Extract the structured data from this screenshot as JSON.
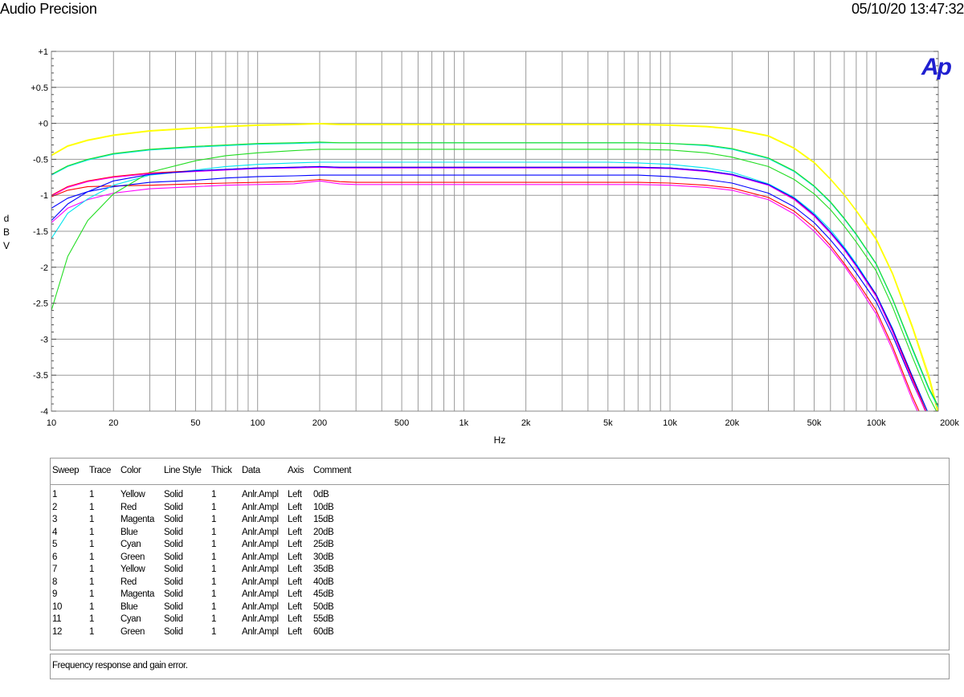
{
  "header": {
    "brand": "Audio Precision",
    "timestamp": "05/10/20 13:47:32"
  },
  "logo": {
    "text": "Ap",
    "color": "#1f1fd0"
  },
  "chart_data": {
    "type": "line",
    "xscale": "log",
    "xlim": [
      10,
      200000
    ],
    "ylim": [
      -4,
      1
    ],
    "xlabel": "Hz",
    "ylabel": "dBV",
    "ylabel_letters": [
      "d",
      "B",
      "V"
    ],
    "grid": true,
    "xticks": [
      {
        "v": 10,
        "label": "10"
      },
      {
        "v": 20,
        "label": "20"
      },
      {
        "v": 50,
        "label": "50"
      },
      {
        "v": 100,
        "label": "100"
      },
      {
        "v": 200,
        "label": "200"
      },
      {
        "v": 500,
        "label": "500"
      },
      {
        "v": 1000,
        "label": "1k"
      },
      {
        "v": 2000,
        "label": "2k"
      },
      {
        "v": 5000,
        "label": "5k"
      },
      {
        "v": 10000,
        "label": "10k"
      },
      {
        "v": 20000,
        "label": "20k"
      },
      {
        "v": 50000,
        "label": "50k"
      },
      {
        "v": 100000,
        "label": "100k"
      },
      {
        "v": 200000,
        "label": "200k"
      }
    ],
    "yticks": [
      {
        "v": 1,
        "label": "+1"
      },
      {
        "v": 0.5,
        "label": "+0.5"
      },
      {
        "v": 0,
        "label": "+0"
      },
      {
        "v": -0.5,
        "label": "-0.5"
      },
      {
        "v": -1,
        "label": "-1"
      },
      {
        "v": -1.5,
        "label": "-1.5"
      },
      {
        "v": -2,
        "label": "-2"
      },
      {
        "v": -2.5,
        "label": "-2.5"
      },
      {
        "v": -3,
        "label": "-3"
      },
      {
        "v": -3.5,
        "label": "-3.5"
      },
      {
        "v": -4,
        "label": "-4"
      }
    ],
    "x": [
      10,
      12,
      15,
      20,
      30,
      50,
      70,
      100,
      150,
      200,
      250,
      300,
      500,
      1000,
      2000,
      3000,
      5000,
      7000,
      10000,
      15000,
      20000,
      30000,
      40000,
      50000,
      60000,
      70000,
      80000,
      100000,
      120000,
      150000,
      180000,
      200000
    ],
    "series": [
      {
        "color": "#ffff00",
        "values": [
          -0.45,
          -0.32,
          -0.24,
          -0.17,
          -0.11,
          -0.07,
          -0.05,
          -0.03,
          -0.02,
          -0.01,
          -0.02,
          -0.02,
          -0.02,
          -0.02,
          -0.02,
          -0.02,
          -0.02,
          -0.02,
          -0.03,
          -0.05,
          -0.08,
          -0.18,
          -0.35,
          -0.55,
          -0.78,
          -1.0,
          -1.22,
          -1.62,
          -2.1,
          -2.85,
          -3.55,
          -4.05
        ]
      },
      {
        "color": "#ff0000",
        "values": [
          -1.02,
          -0.93,
          -0.88,
          -0.87,
          -0.86,
          -0.84,
          -0.83,
          -0.82,
          -0.81,
          -0.78,
          -0.81,
          -0.82,
          -0.82,
          -0.82,
          -0.82,
          -0.82,
          -0.82,
          -0.82,
          -0.83,
          -0.86,
          -0.9,
          -1.03,
          -1.22,
          -1.45,
          -1.7,
          -1.95,
          -2.18,
          -2.6,
          -3.1,
          -3.8,
          -4.3,
          -4.5
        ]
      },
      {
        "color": "#ff00ff",
        "values": [
          -1.38,
          -1.18,
          -1.06,
          -0.97,
          -0.91,
          -0.88,
          -0.86,
          -0.85,
          -0.84,
          -0.8,
          -0.84,
          -0.85,
          -0.85,
          -0.85,
          -0.85,
          -0.85,
          -0.85,
          -0.85,
          -0.86,
          -0.89,
          -0.93,
          -1.06,
          -1.26,
          -1.5,
          -1.74,
          -1.98,
          -2.22,
          -2.65,
          -3.15,
          -3.85,
          -4.35,
          -4.55
        ]
      },
      {
        "color": "#0000ff",
        "values": [
          -1.18,
          -1.04,
          -0.95,
          -0.88,
          -0.82,
          -0.79,
          -0.76,
          -0.74,
          -0.73,
          -0.72,
          -0.72,
          -0.72,
          -0.72,
          -0.72,
          -0.72,
          -0.72,
          -0.72,
          -0.72,
          -0.74,
          -0.78,
          -0.83,
          -0.97,
          -1.16,
          -1.38,
          -1.62,
          -1.85,
          -2.08,
          -2.48,
          -2.95,
          -3.6,
          -4.1,
          -4.3
        ]
      },
      {
        "color": "#00e5ee",
        "values": [
          -1.6,
          -1.25,
          -1.05,
          -0.86,
          -0.72,
          -0.65,
          -0.6,
          -0.57,
          -0.55,
          -0.54,
          -0.54,
          -0.54,
          -0.54,
          -0.54,
          -0.54,
          -0.54,
          -0.54,
          -0.55,
          -0.57,
          -0.62,
          -0.68,
          -0.84,
          -1.03,
          -1.25,
          -1.48,
          -1.72,
          -1.95,
          -2.38,
          -2.85,
          -3.55,
          -4.05,
          -4.3
        ]
      },
      {
        "color": "#22dd22",
        "values": [
          -2.6,
          -1.85,
          -1.35,
          -0.98,
          -0.68,
          -0.52,
          -0.45,
          -0.41,
          -0.38,
          -0.36,
          -0.36,
          -0.36,
          -0.36,
          -0.36,
          -0.36,
          -0.36,
          -0.36,
          -0.36,
          -0.37,
          -0.41,
          -0.47,
          -0.6,
          -0.78,
          -0.98,
          -1.2,
          -1.43,
          -1.65,
          -2.05,
          -2.55,
          -3.25,
          -3.8,
          -4.05
        ]
      },
      {
        "color": "#ffff00",
        "values": [
          -0.44,
          -0.31,
          -0.23,
          -0.16,
          -0.1,
          -0.06,
          -0.04,
          -0.02,
          -0.01,
          0.0,
          -0.01,
          -0.01,
          -0.01,
          -0.01,
          -0.01,
          -0.01,
          -0.01,
          -0.01,
          -0.02,
          -0.04,
          -0.07,
          -0.17,
          -0.34,
          -0.54,
          -0.77,
          -0.99,
          -1.21,
          -1.6,
          -2.08,
          -2.82,
          -3.5,
          -4.0
        ]
      },
      {
        "color": "#ff0000",
        "values": [
          -1.0,
          -0.88,
          -0.8,
          -0.74,
          -0.69,
          -0.66,
          -0.64,
          -0.62,
          -0.61,
          -0.6,
          -0.61,
          -0.61,
          -0.61,
          -0.61,
          -0.61,
          -0.61,
          -0.61,
          -0.61,
          -0.62,
          -0.66,
          -0.71,
          -0.85,
          -1.05,
          -1.28,
          -1.52,
          -1.75,
          -1.98,
          -2.4,
          -2.88,
          -3.55,
          -4.1,
          -4.3
        ]
      },
      {
        "color": "#ff00ff",
        "values": [
          -1.01,
          -0.89,
          -0.81,
          -0.75,
          -0.7,
          -0.67,
          -0.65,
          -0.63,
          -0.62,
          -0.61,
          -0.62,
          -0.62,
          -0.62,
          -0.62,
          -0.62,
          -0.62,
          -0.62,
          -0.62,
          -0.63,
          -0.67,
          -0.72,
          -0.86,
          -1.06,
          -1.29,
          -1.53,
          -1.76,
          -1.99,
          -2.41,
          -2.9,
          -3.58,
          -4.12,
          -4.32
        ]
      },
      {
        "color": "#0000ff",
        "values": [
          -1.35,
          -1.12,
          -0.95,
          -0.8,
          -0.71,
          -0.66,
          -0.64,
          -0.62,
          -0.61,
          -0.6,
          -0.61,
          -0.61,
          -0.61,
          -0.61,
          -0.61,
          -0.61,
          -0.61,
          -0.61,
          -0.62,
          -0.66,
          -0.71,
          -0.85,
          -1.04,
          -1.27,
          -1.51,
          -1.74,
          -1.97,
          -2.38,
          -2.86,
          -3.52,
          -4.05,
          -4.25
        ]
      },
      {
        "color": "#00e5ee",
        "values": [
          -0.72,
          -0.6,
          -0.51,
          -0.43,
          -0.37,
          -0.33,
          -0.31,
          -0.29,
          -0.28,
          -0.27,
          -0.27,
          -0.27,
          -0.27,
          -0.27,
          -0.27,
          -0.27,
          -0.27,
          -0.27,
          -0.28,
          -0.31,
          -0.36,
          -0.49,
          -0.67,
          -0.88,
          -1.1,
          -1.33,
          -1.55,
          -1.96,
          -2.45,
          -3.15,
          -3.7,
          -3.95
        ]
      },
      {
        "color": "#22dd22",
        "values": [
          -0.71,
          -0.59,
          -0.5,
          -0.42,
          -0.36,
          -0.32,
          -0.3,
          -0.28,
          -0.27,
          -0.26,
          -0.27,
          -0.27,
          -0.27,
          -0.27,
          -0.27,
          -0.27,
          -0.27,
          -0.27,
          -0.28,
          -0.3,
          -0.35,
          -0.48,
          -0.66,
          -0.87,
          -1.09,
          -1.32,
          -1.54,
          -1.95,
          -2.44,
          -3.13,
          -3.68,
          -3.93
        ]
      }
    ]
  },
  "legend": {
    "columns": [
      "Sweep",
      "Trace",
      "Color",
      "Line Style",
      "Thick",
      "Data",
      "Axis",
      "Comment"
    ],
    "rows": [
      [
        "1",
        "1",
        "Yellow",
        "Solid",
        "1",
        "Anlr.Ampl",
        "Left",
        "0dB"
      ],
      [
        "2",
        "1",
        "Red",
        "Solid",
        "1",
        "Anlr.Ampl",
        "Left",
        "10dB"
      ],
      [
        "3",
        "1",
        "Magenta",
        "Solid",
        "1",
        "Anlr.Ampl",
        "Left",
        "15dB"
      ],
      [
        "4",
        "1",
        "Blue",
        "Solid",
        "1",
        "Anlr.Ampl",
        "Left",
        "20dB"
      ],
      [
        "5",
        "1",
        "Cyan",
        "Solid",
        "1",
        "Anlr.Ampl",
        "Left",
        "25dB"
      ],
      [
        "6",
        "1",
        "Green",
        "Solid",
        "1",
        "Anlr.Ampl",
        "Left",
        "30dB"
      ],
      [
        "7",
        "1",
        "Yellow",
        "Solid",
        "1",
        "Anlr.Ampl",
        "Left",
        "35dB"
      ],
      [
        "8",
        "1",
        "Red",
        "Solid",
        "1",
        "Anlr.Ampl",
        "Left",
        "40dB"
      ],
      [
        "9",
        "1",
        "Magenta",
        "Solid",
        "1",
        "Anlr.Ampl",
        "Left",
        "45dB"
      ],
      [
        "10",
        "1",
        "Blue",
        "Solid",
        "1",
        "Anlr.Ampl",
        "Left",
        "50dB"
      ],
      [
        "11",
        "1",
        "Cyan",
        "Solid",
        "1",
        "Anlr.Ampl",
        "Left",
        "55dB"
      ],
      [
        "12",
        "1",
        "Green",
        "Solid",
        "1",
        "Anlr.Ampl",
        "Left",
        "60dB"
      ]
    ]
  },
  "comment": "Frequency response and gain error."
}
